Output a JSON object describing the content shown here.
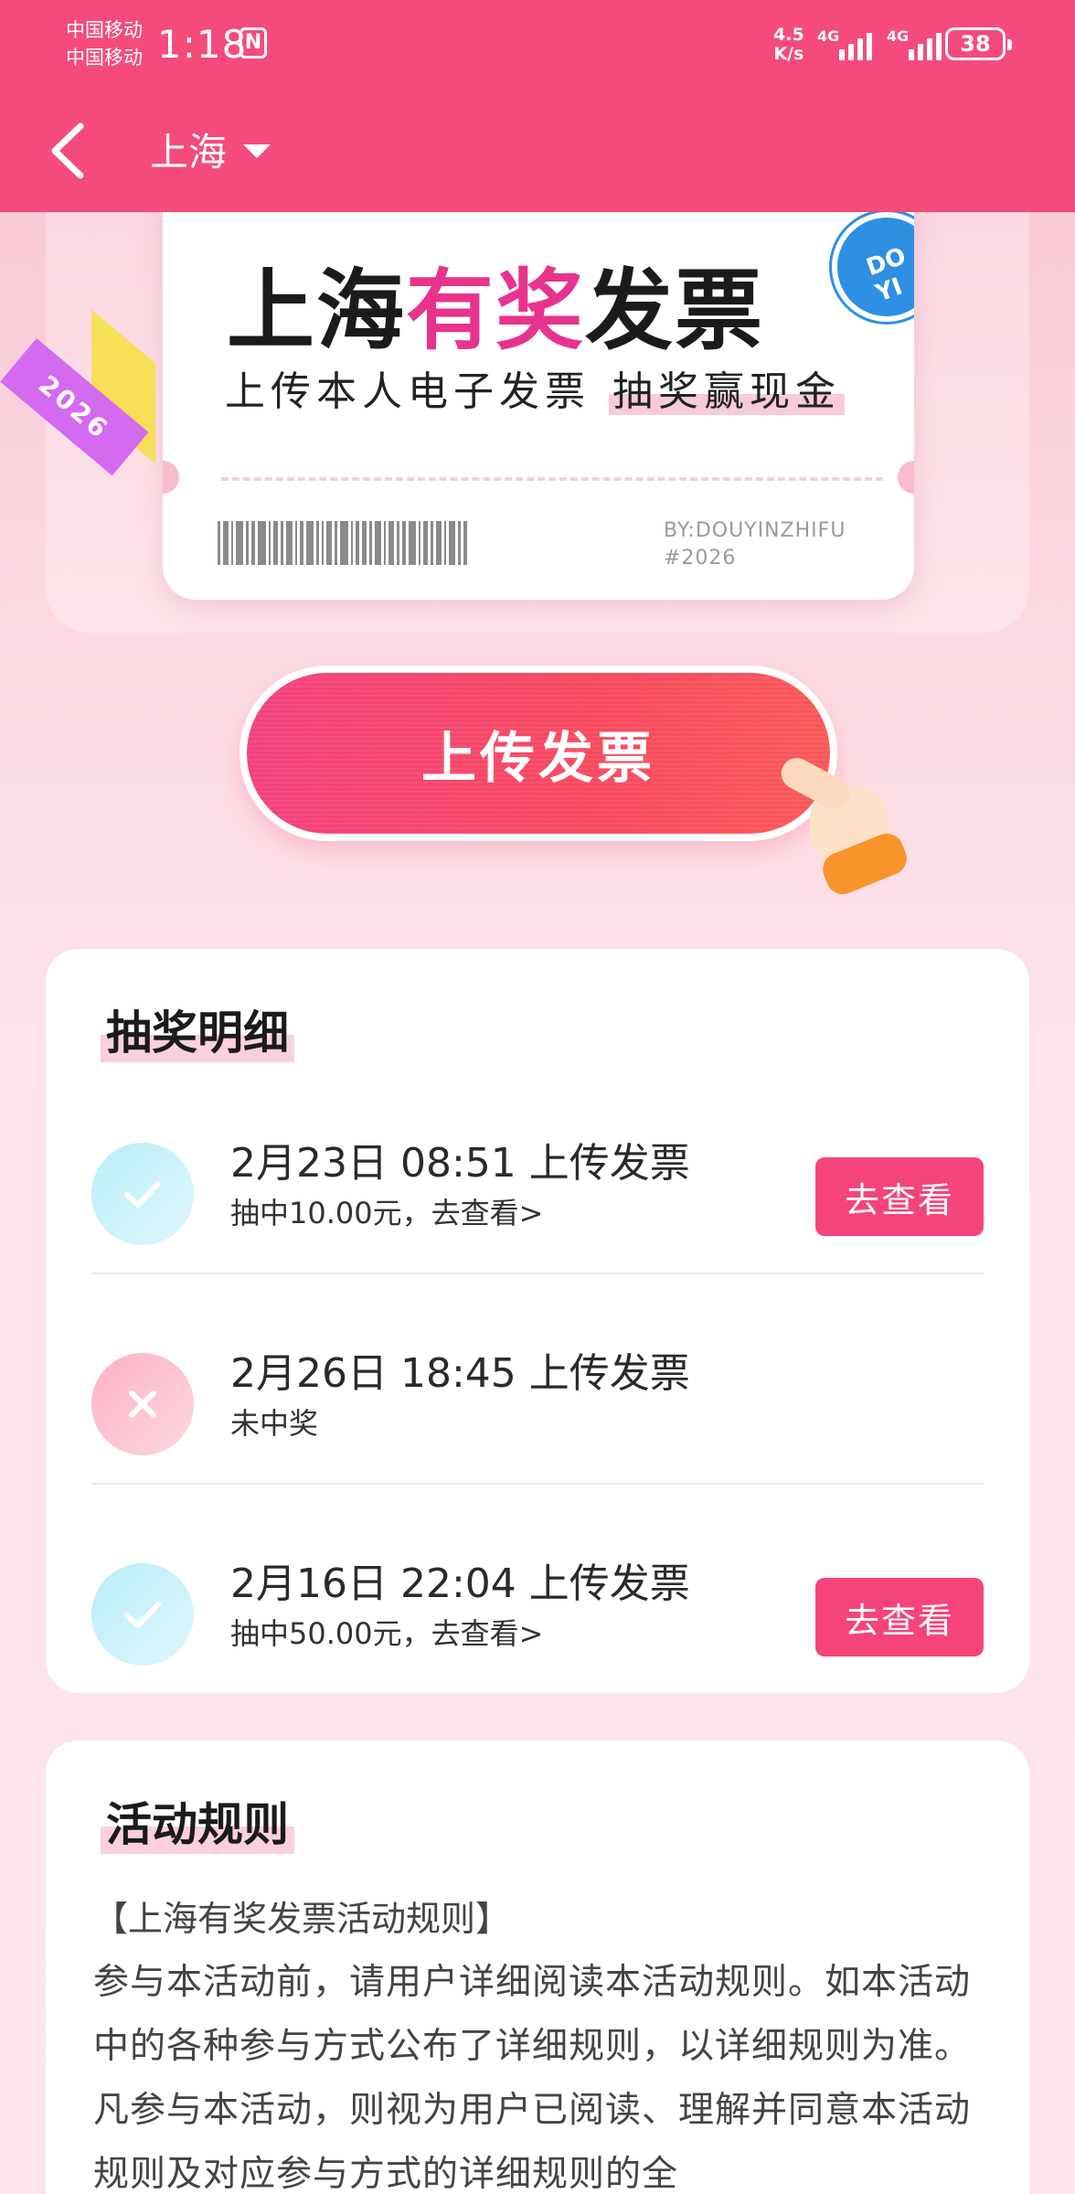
{
  "status_bar": {
    "carrier_1": "中国移动",
    "carrier_2": "中国移动",
    "time": "1:18",
    "nfc": "N",
    "net_speed_value": "4.5",
    "net_speed_unit": "K/s",
    "signal_1_label": "4G",
    "signal_2_label": "4G",
    "battery": "38"
  },
  "header": {
    "city": "上海"
  },
  "hero": {
    "ribbon_year": "2026",
    "title_part1": "上海",
    "title_highlight": "有奖",
    "title_part2": "发票",
    "subtitle_part1": "上传本人电子发票",
    "subtitle_highlight": "抽奖赢现金",
    "globe_text": "DO YI",
    "by_line1": "BY:DOUYINZHIFU",
    "by_line2": "#2026"
  },
  "upload_button": "上传发票",
  "lottery": {
    "title": "抽奖明细",
    "rows": [
      {
        "status": "win",
        "title": "2月23日 08:51 上传发票",
        "desc": "抽中10.00元，去查看>",
        "button": "去查看"
      },
      {
        "status": "lose",
        "title": "2月26日 18:45 上传发票",
        "desc": "未中奖",
        "button": ""
      },
      {
        "status": "win",
        "title": "2月16日 22:04 上传发票",
        "desc": "抽中50.00元，去查看>",
        "button": "去查看"
      }
    ]
  },
  "rules": {
    "title": "活动规则",
    "heading": "【上海有奖发票活动规则】",
    "body": "参与本活动前，请用户详细阅读本活动规则。如本活动中的各种参与方式公布了详细规则，以详细规则为准。凡参与本活动，则视为用户已阅读、理解并同意本活动规则及对应参与方式的详细规则的全"
  },
  "colors": {
    "brand_pink": "#f54b7c",
    "highlight_magenta": "#e8338d",
    "win_icon": "#b9edf7",
    "lose_icon": "#fbb2c3",
    "view_button": "#f5447a"
  }
}
